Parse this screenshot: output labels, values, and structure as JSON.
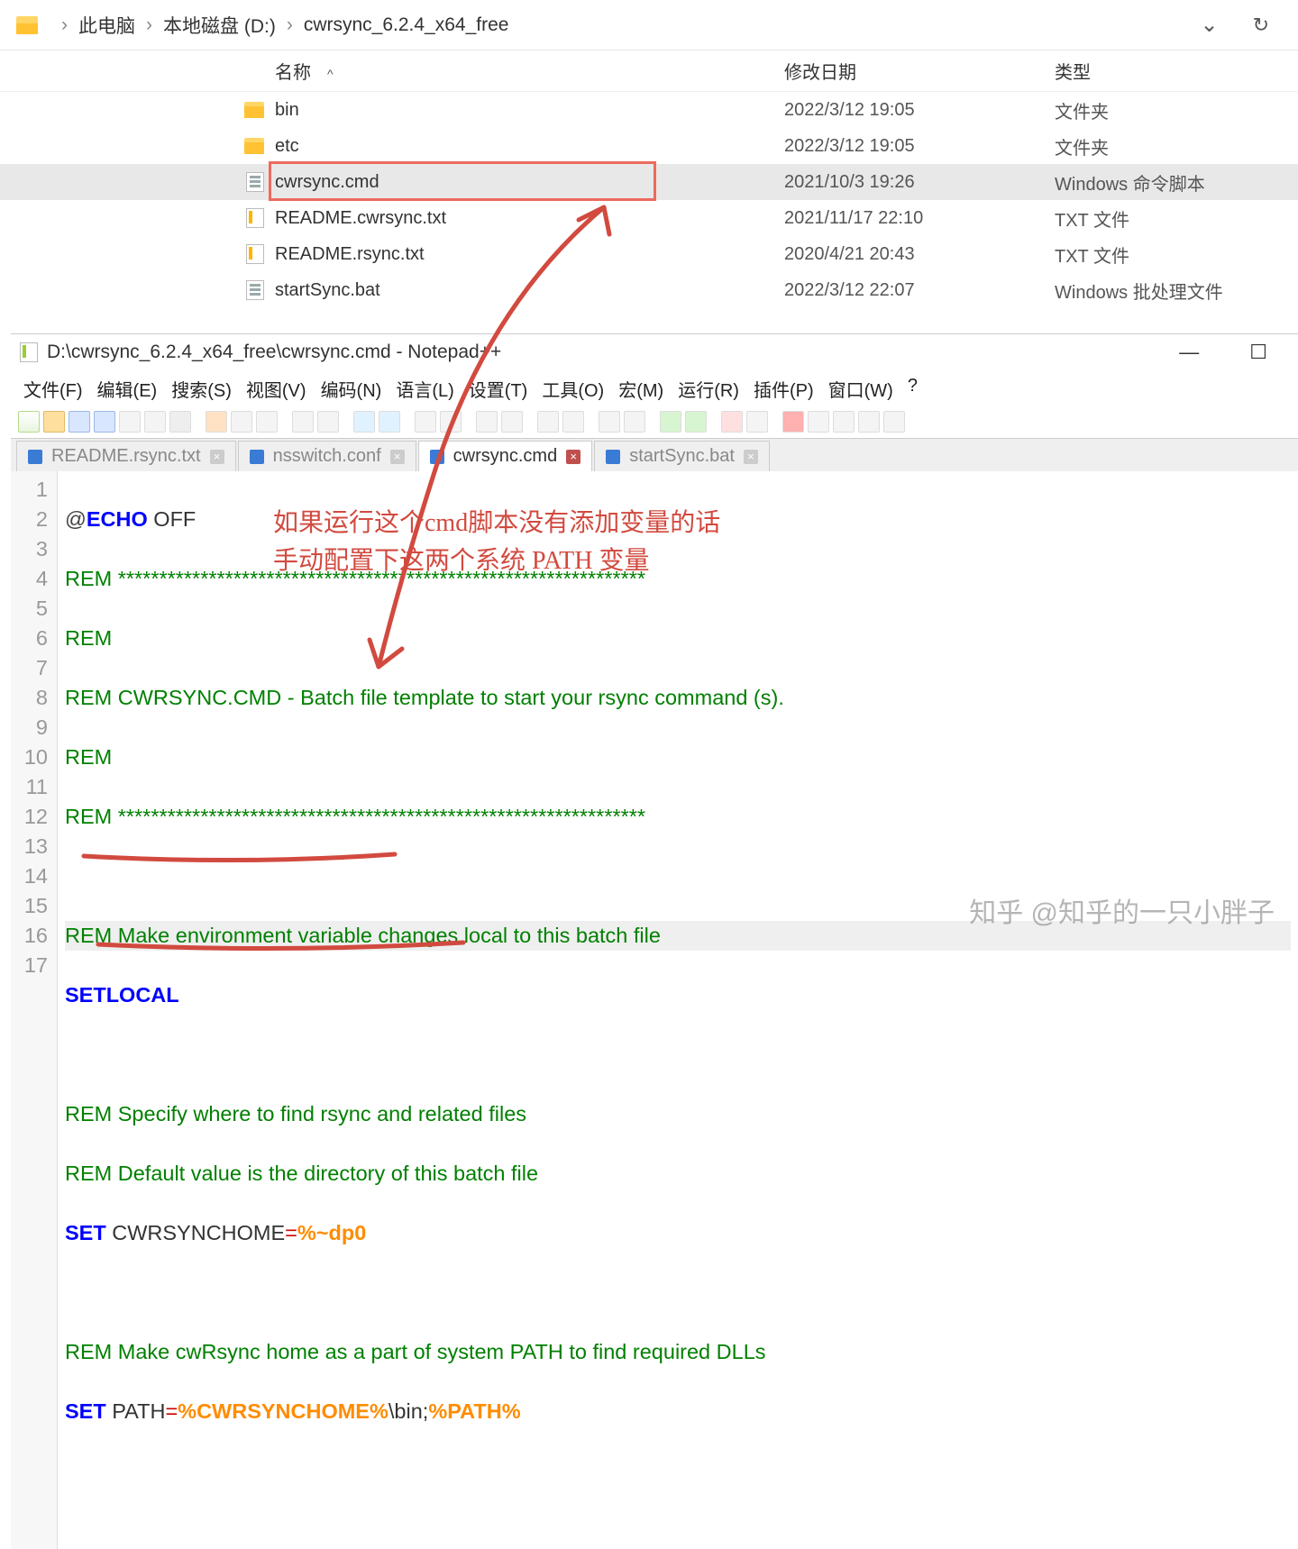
{
  "breadcrumb": {
    "items": [
      "此电脑",
      "本地磁盘 (D:)",
      "cwrsync_6.2.4_x64_free"
    ]
  },
  "columns": {
    "name": "名称",
    "date": "修改日期",
    "type": "类型"
  },
  "files": [
    {
      "name": "bin",
      "date": "2022/3/12 19:05",
      "type": "文件夹",
      "icon": "folder"
    },
    {
      "name": "etc",
      "date": "2022/3/12 19:05",
      "type": "文件夹",
      "icon": "folder"
    },
    {
      "name": "cwrsync.cmd",
      "date": "2021/10/3 19:26",
      "type": "Windows 命令脚本",
      "icon": "cmdfile",
      "sel": true
    },
    {
      "name": "README.cwrsync.txt",
      "date": "2021/11/17 22:10",
      "type": "TXT 文件",
      "icon": "txtfile"
    },
    {
      "name": "README.rsync.txt",
      "date": "2020/4/21 20:43",
      "type": "TXT 文件",
      "icon": "txtfile"
    },
    {
      "name": "startSync.bat",
      "date": "2022/3/12 22:07",
      "type": "Windows 批处理文件",
      "icon": "cmdfile"
    }
  ],
  "npp": {
    "title": "D:\\cwrsync_6.2.4_x64_free\\cwrsync.cmd - Notepad++",
    "menus": [
      "文件(F)",
      "编辑(E)",
      "搜索(S)",
      "视图(V)",
      "编码(N)",
      "语言(L)",
      "设置(T)",
      "工具(O)",
      "宏(M)",
      "运行(R)",
      "插件(P)",
      "窗口(W)",
      "?"
    ],
    "tabs": [
      {
        "label": "README.rsync.txt",
        "active": false
      },
      {
        "label": "nsswitch.conf",
        "active": false
      },
      {
        "label": "cwrsync.cmd",
        "active": true
      },
      {
        "label": "startSync.bat",
        "active": false
      }
    ],
    "lines": 17,
    "code": {
      "l1a": "@",
      "l1b": "ECHO",
      "l1c": " OFF",
      "l2": "REM ****************************************************************",
      "l3": "REM",
      "l4": "REM CWRSYNC.CMD - Batch file template to start your rsync command (s).",
      "l5": "REM",
      "l6": "REM ****************************************************************",
      "l8": "REM Make environment variable changes local to this batch file",
      "l9": "SETLOCAL",
      "l11": "REM Specify where to find rsync and related files",
      "l12": "REM Default value is the directory of this batch file",
      "l13a": "SET",
      "l13b": " CWRSYNCHOME",
      "l13c": "=",
      "l13d": "%~dp0",
      "l15": "REM Make cwRsync home as a part of system PATH to find required DLLs",
      "l16a": "SET",
      "l16b": " PATH",
      "l16c": "=",
      "l16d": "%CWRSYNCHOME%",
      "l16e": "\\bin;",
      "l16f": "%PATH%"
    }
  },
  "annotations": {
    "l1": "如果运行这个cmd脚本没有添加变量的话",
    "l2": "手动配置下这两个系统 PATH 变量"
  },
  "watermark": "知乎 @知乎的一只小胖子"
}
